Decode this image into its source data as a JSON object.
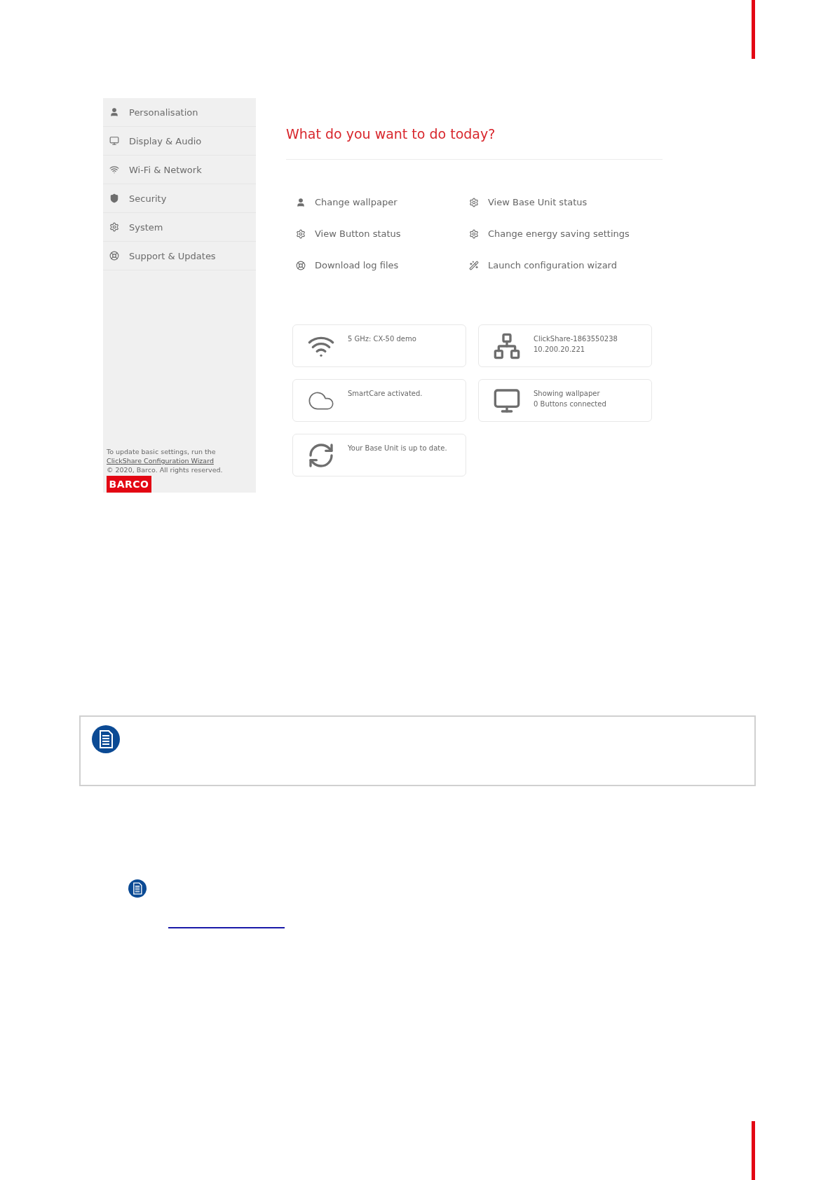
{
  "sidebar": {
    "items": [
      {
        "label": "Personalisation"
      },
      {
        "label": "Display & Audio"
      },
      {
        "label": "Wi-Fi & Network"
      },
      {
        "label": "Security"
      },
      {
        "label": "System"
      },
      {
        "label": "Support & Updates"
      }
    ],
    "footer": {
      "text": "To update basic settings, run the",
      "link": "ClickShare Configuration Wizard",
      "copyright": "© 2020, Barco. All rights reserved.",
      "logo": "BARCO"
    }
  },
  "main": {
    "title": "What do you want to do today?",
    "actions": [
      {
        "label": "Change wallpaper"
      },
      {
        "label": "View Base Unit status"
      },
      {
        "label": "View Button status"
      },
      {
        "label": "Change energy saving settings"
      },
      {
        "label": "Download log files"
      },
      {
        "label": "Launch configuration wizard"
      }
    ],
    "cards": [
      {
        "lines": [
          "5 GHz: CX-50 demo"
        ]
      },
      {
        "lines": [
          "ClickShare-1863550238",
          "10.200.20.221"
        ]
      },
      {
        "lines": [
          "SmartCare activated."
        ]
      },
      {
        "lines": [
          "Showing wallpaper",
          "0 Buttons connected"
        ]
      },
      {
        "lines": [
          "Your Base Unit is up to date."
        ]
      }
    ]
  }
}
